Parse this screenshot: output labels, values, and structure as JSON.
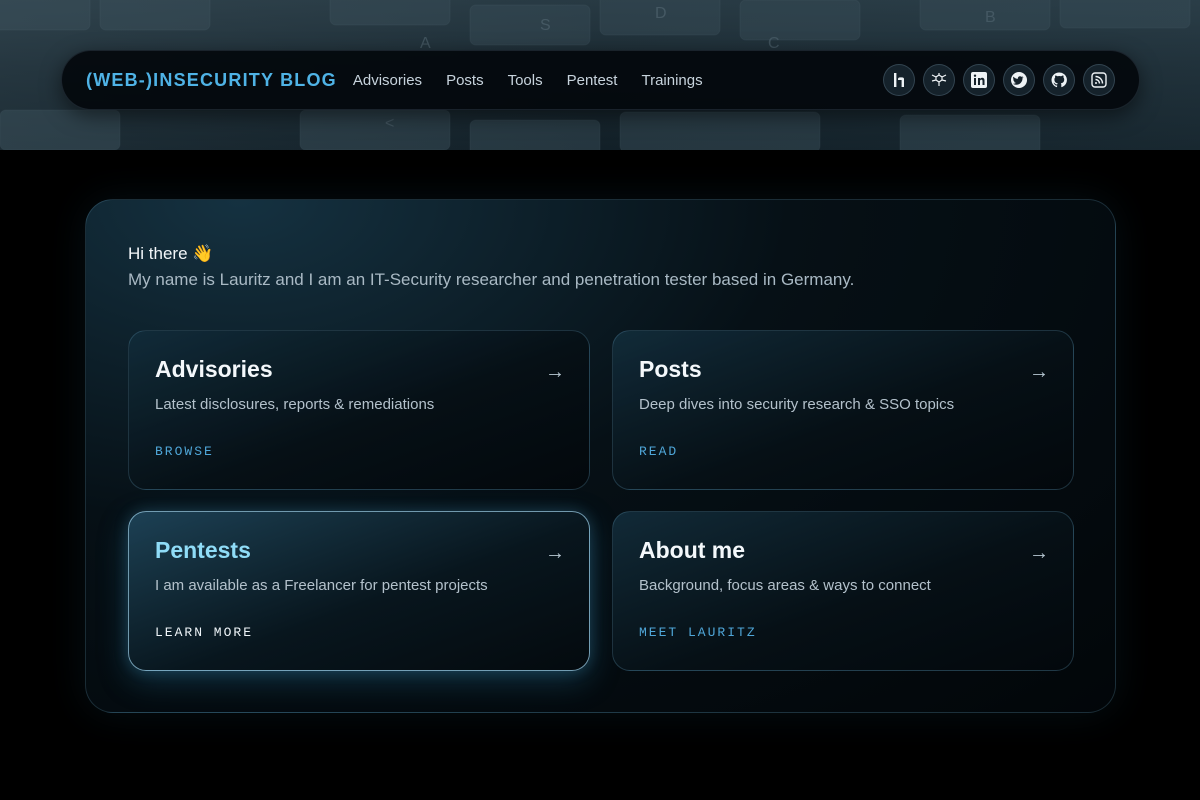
{
  "nav": {
    "brand": "(WEB-)INSECURITY BLOG",
    "links": [
      "Advisories",
      "Posts",
      "Tools",
      "Pentest",
      "Trainings"
    ],
    "socials": [
      "hackerone-icon",
      "bugcrowd-icon",
      "linkedin-icon",
      "twitter-icon",
      "github-icon",
      "rss-icon"
    ]
  },
  "intro": {
    "greeting": "Hi there 👋",
    "text": "My name is Lauritz and I am an IT-Security researcher and penetration tester based in Germany."
  },
  "cards": [
    {
      "title": "Advisories",
      "description": "Latest disclosures, reports & remediations",
      "cta": "BROWSE",
      "arrow": "→"
    },
    {
      "title": "Posts",
      "description": "Deep dives into security research & SSO topics",
      "cta": "READ",
      "arrow": "→"
    },
    {
      "title": "Pentests",
      "description": "I am available as a Freelancer for pentest projects",
      "cta": "LEARN MORE",
      "arrow": "→"
    },
    {
      "title": "About me",
      "description": "Background, focus areas & ways to connect",
      "cta": "MEET LAURITZ",
      "arrow": "→"
    }
  ],
  "colors": {
    "accent": "#4fb3e6",
    "highlight_title": "#8fdcf7",
    "background": "#000000"
  }
}
